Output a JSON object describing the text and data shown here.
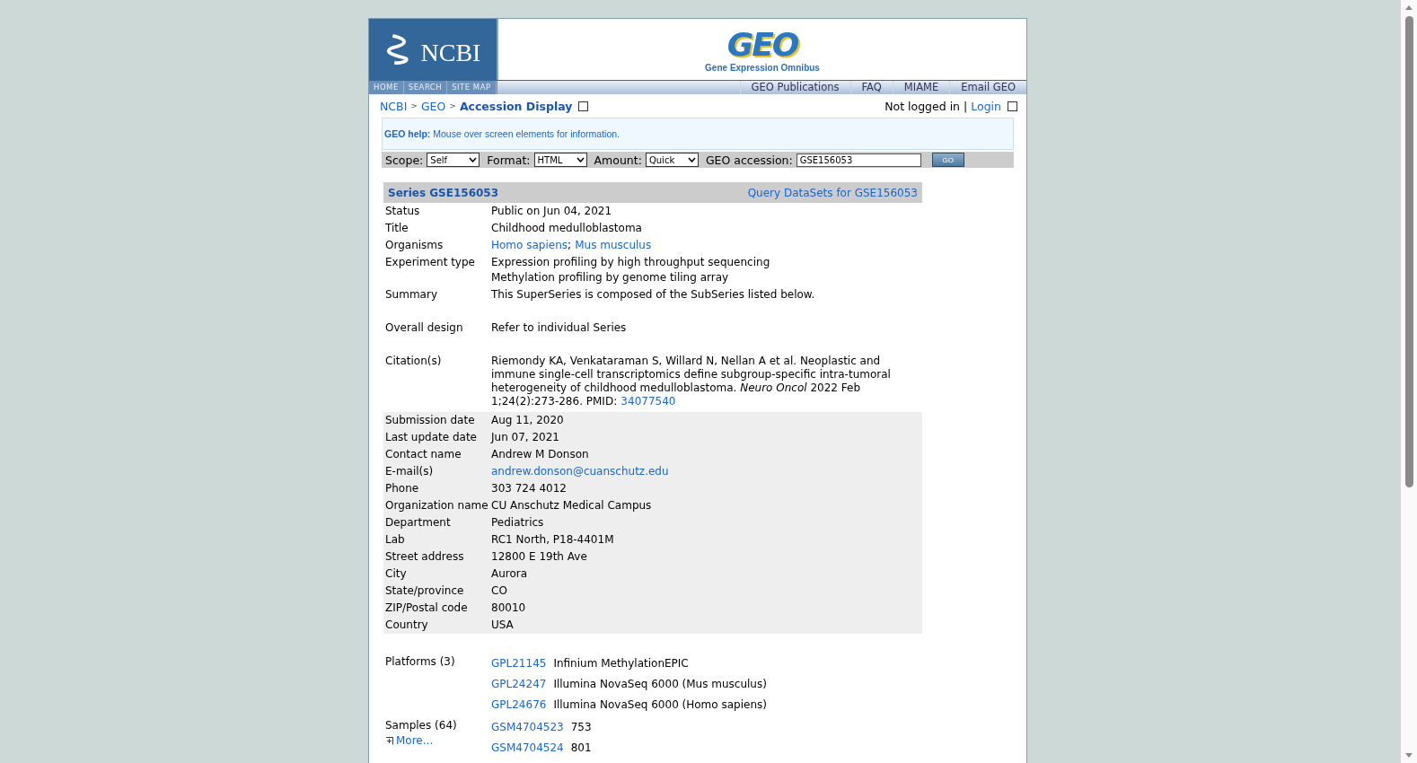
{
  "header": {
    "ncbi_logo": "NCBI",
    "geo_logo": "GEO",
    "geo_subtitle": "Gene Expression Omnibus"
  },
  "nav_left": [
    "HOME",
    "SEARCH",
    "SITE MAP"
  ],
  "nav_right": [
    "GEO Publications",
    "FAQ",
    "MIAME",
    "Email GEO"
  ],
  "breadcrumb": {
    "links": [
      "NCBI",
      "GEO"
    ],
    "separator": ">",
    "current": "Accession Display",
    "status": "Not logged in",
    "divider": "|",
    "login": "Login"
  },
  "help": {
    "label": "GEO help:",
    "text": "Mouse over screen elements for information."
  },
  "form": {
    "fields": [
      {
        "label": "Scope:",
        "kind": "select",
        "value": "Self"
      },
      {
        "label": "Format:",
        "kind": "select",
        "value": "HTML"
      },
      {
        "label": "Amount:",
        "kind": "select",
        "value": "Quick"
      },
      {
        "label": "GEO accession:",
        "kind": "input",
        "value": "GSE156053"
      }
    ],
    "button": "GO"
  },
  "series": {
    "heading": "Series GSE156053",
    "query_link": "Query DataSets for GSE156053"
  },
  "sections": [
    {
      "shaded": false,
      "rows": [
        {
          "label": "Status",
          "lines": [
            [
              {
                "kind": "text",
                "text": "Public on Jun 04, 2021"
              }
            ]
          ]
        },
        {
          "label": "Title",
          "lines": [
            [
              {
                "kind": "text",
                "text": "Childhood medulloblastoma"
              }
            ]
          ]
        },
        {
          "label": "Organisms",
          "lines": [
            [
              {
                "kind": "link",
                "text": "Homo sapiens"
              },
              {
                "kind": "text",
                "text": ";"
              },
              {
                "kind": "link",
                "text": "Mus musculus"
              }
            ]
          ]
        },
        {
          "label": "Experiment type",
          "lines": [
            [
              {
                "kind": "text",
                "text": "Expression profiling by high throughput sequencing"
              }
            ],
            [
              {
                "kind": "text",
                "text": "Methylation profiling by genome tiling array"
              }
            ]
          ]
        },
        {
          "label": "Summary",
          "lines": [
            [
              {
                "kind": "text",
                "text": "This SuperSeries is composed of the SubSeries listed below."
              }
            ]
          ]
        }
      ]
    },
    {
      "shaded": false,
      "rows": [
        {
          "label": "Overall design",
          "lines": [
            [
              {
                "kind": "text",
                "text": "Refer to individual Series"
              }
            ]
          ]
        }
      ]
    },
    {
      "shaded": false,
      "rows": [
        {
          "label": "Citation(s)",
          "lines": [
            [
              {
                "kind": "text",
                "text": "Riemondy KA, Venkataraman S, Willard N, Nellan A et al. Neoplastic and immune single-cell transcriptomics define subgroup-specific intra-tumoral heterogeneity of childhood medulloblastoma. *Neuro Oncol* 2022 Feb 1;24(2):273-286. PMID:"
              },
              {
                "kind": "link",
                "text": "34077540"
              }
            ]
          ]
        }
      ]
    },
    {
      "shaded": true,
      "rows": [
        {
          "label": "Submission date",
          "lines": [
            [
              {
                "kind": "text",
                "text": "Aug 11, 2020"
              }
            ]
          ]
        },
        {
          "label": "Last update date",
          "lines": [
            [
              {
                "kind": "text",
                "text": "Jun 07, 2021"
              }
            ]
          ]
        },
        {
          "label": "Contact name",
          "lines": [
            [
              {
                "kind": "text",
                "text": "Andrew M Donson"
              }
            ]
          ]
        },
        {
          "label": "E-mail(s)",
          "lines": [
            [
              {
                "kind": "link",
                "text": "andrew.donson@cuanschutz.edu"
              }
            ]
          ]
        },
        {
          "label": "Phone",
          "lines": [
            [
              {
                "kind": "text",
                "text": "303 724 4012"
              }
            ]
          ]
        },
        {
          "label": "Organization name",
          "lines": [
            [
              {
                "kind": "text",
                "text": "CU Anschutz Medical Campus"
              }
            ]
          ]
        },
        {
          "label": "Department",
          "lines": [
            [
              {
                "kind": "text",
                "text": "Pediatrics"
              }
            ]
          ]
        },
        {
          "label": "Lab",
          "lines": [
            [
              {
                "kind": "text",
                "text": "RC1 North, P18-4401M"
              }
            ]
          ]
        },
        {
          "label": "Street address",
          "lines": [
            [
              {
                "kind": "text",
                "text": "12800 E 19th Ave"
              }
            ]
          ]
        },
        {
          "label": "City",
          "lines": [
            [
              {
                "kind": "text",
                "text": "Aurora"
              }
            ]
          ]
        },
        {
          "label": "State/province",
          "lines": [
            [
              {
                "kind": "text",
                "text": "CO"
              }
            ]
          ]
        },
        {
          "label": "ZIP/Postal code",
          "lines": [
            [
              {
                "kind": "text",
                "text": "80010"
              }
            ]
          ]
        },
        {
          "label": "Country",
          "lines": [
            [
              {
                "kind": "text",
                "text": "USA"
              }
            ]
          ]
        }
      ]
    }
  ],
  "platforms": {
    "label": "Platforms (3)",
    "items": [
      {
        "accession": "GPL21145",
        "name": "Infinium MethylationEPIC"
      },
      {
        "accession": "GPL24247",
        "name": "Illumina NovaSeq 6000 (Mus musculus)"
      },
      {
        "accession": "GPL24676",
        "name": "Illumina NovaSeq 6000 (Homo sapiens)"
      }
    ]
  },
  "samples": {
    "label": "Samples (64)",
    "more": "More...",
    "items": [
      {
        "accession": "GSM4704523",
        "name": "753"
      },
      {
        "accession": "GSM4704524",
        "name": "801"
      }
    ]
  }
}
